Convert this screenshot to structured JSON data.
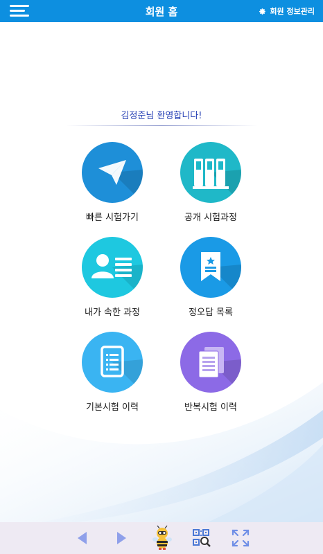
{
  "header": {
    "title": "회원 홈",
    "settings_label": "회원 정보관리"
  },
  "welcome_text": "김정준님 환영합니다!",
  "menu": [
    {
      "label": "빠른 시험가기",
      "icon": "paper-plane-icon",
      "color": "#1e8fd8"
    },
    {
      "label": "공개 시험과정",
      "icon": "books-icon",
      "color": "#1fb8c8"
    },
    {
      "label": "내가 속한 과정",
      "icon": "user-card-icon",
      "color": "#1ec8e0"
    },
    {
      "label": "정오답 목록",
      "icon": "bookmark-icon",
      "color": "#1a9ae6"
    },
    {
      "label": "기본시험 이력",
      "icon": "document-icon",
      "color": "#3ab4f2"
    },
    {
      "label": "반복시험 이력",
      "icon": "documents-stack-icon",
      "color": "#8c6ae6"
    }
  ],
  "colors": {
    "topbar": "#0d8fe0",
    "welcome_text": "#2a43b6",
    "bottombar": "#eeeaf3",
    "nav_arrow": "#8fa0ea"
  }
}
